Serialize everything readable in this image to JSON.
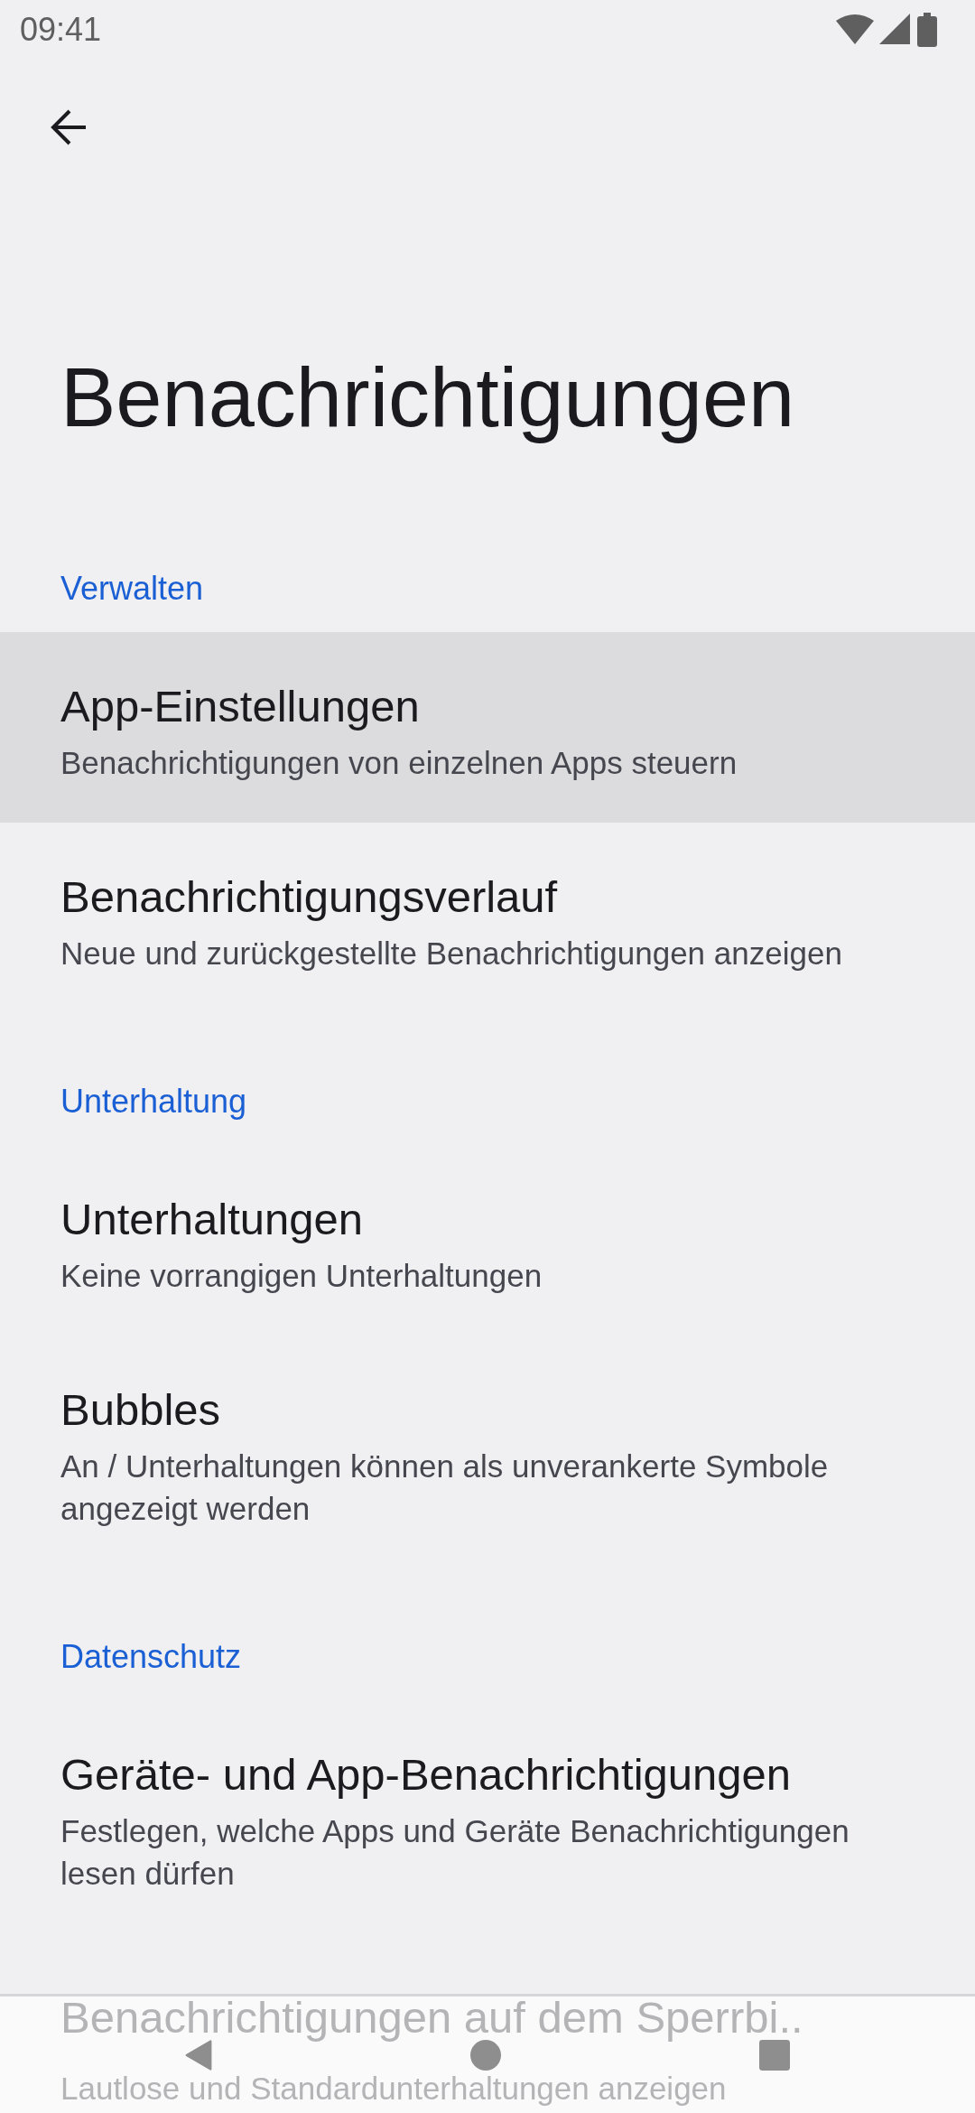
{
  "status_bar": {
    "time": "09:41"
  },
  "title": "Benachrichtigungen",
  "sections": [
    {
      "header": "Verwalten",
      "items": [
        {
          "title": "App-Einstellungen",
          "summary": "Benachrichtigungen von einzelnen Apps steuern",
          "selected": true
        },
        {
          "title": "Benachrichtigungsverlauf",
          "summary": "Neue und zurückgestellte Benachrichtigungen anzeigen",
          "selected": false
        }
      ]
    },
    {
      "header": "Unterhaltung",
      "items": [
        {
          "title": "Unterhaltungen",
          "summary": "Keine vorrangigen Unterhaltungen",
          "selected": false
        },
        {
          "title": "Bubbles",
          "summary": "An / Unterhaltungen können als unverankerte Symbole angezeigt werden",
          "selected": false
        }
      ]
    },
    {
      "header": "Datenschutz",
      "items": [
        {
          "title": "Geräte- und App-Benachrichtigungen",
          "summary": "Festlegen, welche Apps und Geräte Benachrichtigungen lesen dürfen",
          "selected": false
        },
        {
          "title": "Benachrichtigungen auf dem Sperrbi..",
          "summary": "Lautlose und Standardunterhaltungen anzeigen",
          "selected": false
        }
      ]
    }
  ]
}
